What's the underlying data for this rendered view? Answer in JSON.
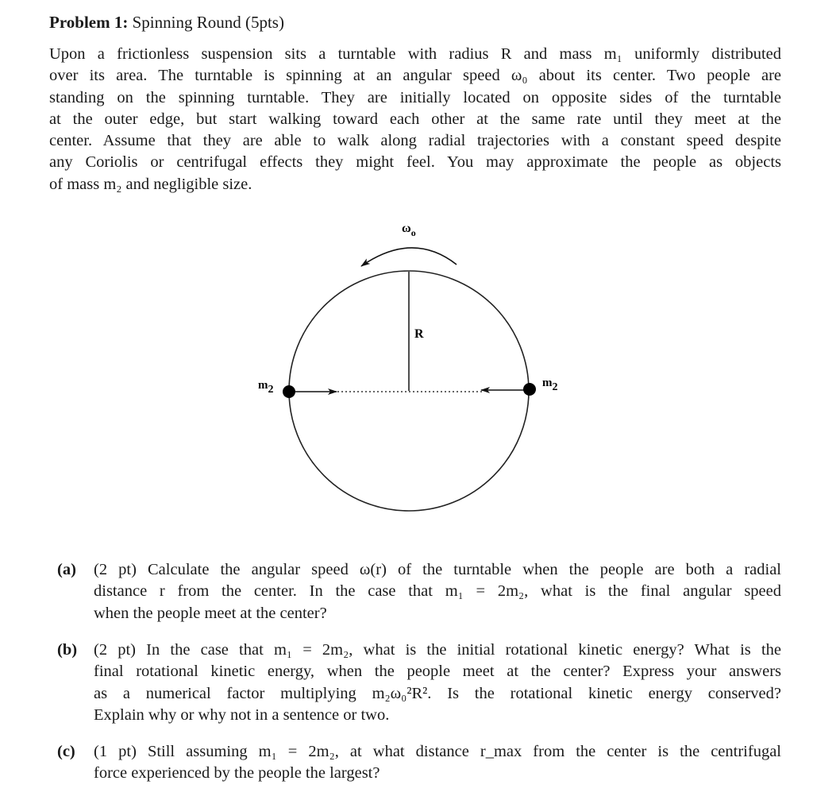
{
  "problem": {
    "heading_bold": "Problem 1:",
    "heading_rest": " Spinning Round (5pts)",
    "intro_lines": [
      "Upon a frictionless suspension sits a turntable with radius R and mass m₁ uniformly distributed",
      "over its area. The turntable is spinning at an angular speed ω₀ about its center. Two people are",
      "standing on the spinning turntable. They are initially located on opposite sides of the turntable",
      "at the outer edge, but start walking toward each other at the same rate until they meet at the",
      "center. Assume that they are able to walk along radial trajectories with a constant speed despite",
      "any Coriolis or centrifugal effects they might feel. You may approximate the people as objects",
      "of mass m₂ and negligible size."
    ]
  },
  "diagram": {
    "omega_label": "ω",
    "omega_sub": "o",
    "radius_label": "R",
    "mass_left_label": "m",
    "mass_left_sub": "2",
    "mass_right_label": "m",
    "mass_right_sub": "2"
  },
  "parts": [
    {
      "label": "(a)",
      "lines": [
        "(2 pt) Calculate the angular speed ω(r) of the turntable when the people are both a radial",
        "distance r from the center. In the case that m₁ = 2m₂, what is the final angular speed",
        "when the people meet at the center?"
      ]
    },
    {
      "label": "(b)",
      "lines": [
        "(2 pt) In the case that m₁ = 2m₂, what is the initial rotational kinetic energy? What is the",
        "final rotational kinetic energy, when the people meet at the center? Express your answers",
        "as a numerical factor multiplying m₂ω₀²R². Is the rotational kinetic energy conserved?",
        "Explain why or why not in a sentence or two."
      ]
    },
    {
      "label": "(c)",
      "lines": [
        "(1 pt) Still assuming m₁ = 2m₂, at what distance r_max from the center is the centrifugal",
        "force experienced by the people the largest?"
      ]
    }
  ]
}
